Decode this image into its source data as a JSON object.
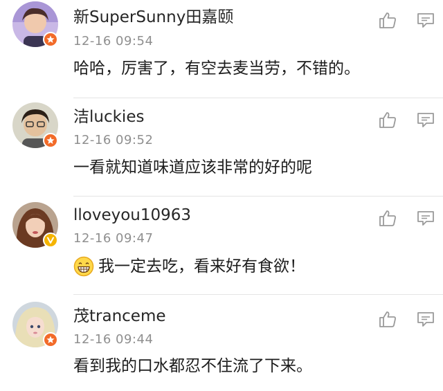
{
  "comments": [
    {
      "username": "新SuperSunny田嘉颐",
      "time": "12-16 09:54",
      "text": "哈哈，厉害了，有空去麦当劳，不错的。",
      "badge_color": "#f26b29",
      "badge_icon": "star-badge-icon"
    },
    {
      "username": "洁luckies",
      "time": "12-16 09:52",
      "text": "一看就知道味道应该非常的好的呢",
      "badge_color": "#f26b29",
      "badge_icon": "star-badge-icon"
    },
    {
      "username": "lloveyou10963",
      "time": "12-16 09:47",
      "text": "我一定去吃，看来好有食欲！",
      "emoji": "grin-emoji",
      "badge_color": "#f5b400",
      "badge_icon": "verified-v-badge-icon"
    },
    {
      "username": "茂tranceme",
      "time": "12-16 09:44",
      "text": "看到我的口水都忍不住流了下来。",
      "badge_color": "#f26b29",
      "badge_icon": "star-badge-icon"
    }
  ],
  "icons": {
    "like": "thumbs-up-icon",
    "reply": "comment-bubble-icon"
  },
  "colors": {
    "username": "#262626",
    "timestamp": "#8f8f8f",
    "icon": "#9a9a9a",
    "divider": "#e4e4e4"
  }
}
